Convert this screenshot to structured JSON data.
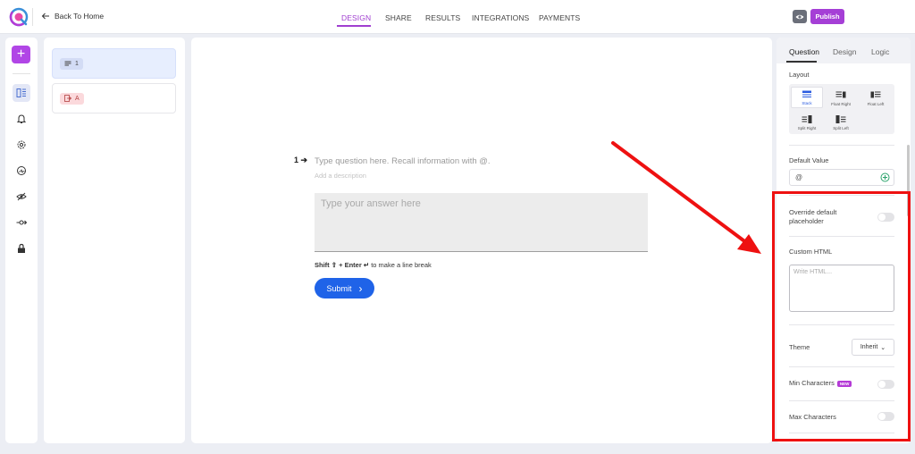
{
  "topbar": {
    "back_label": "Back To Home",
    "tabs": [
      {
        "label": "DESIGN",
        "active": true
      },
      {
        "label": "SHARE",
        "active": false
      },
      {
        "label": "RESULTS",
        "active": false
      },
      {
        "label": "INTEGRATIONS",
        "active": false
      },
      {
        "label": "PAYMENTS",
        "active": false
      }
    ],
    "publish_label": "Publish",
    "accent_color": "#a53fd6"
  },
  "rail": {
    "add_label": "+",
    "icons": [
      "layout-icon",
      "bell-icon",
      "settings-icon",
      "speedometer-icon",
      "eye-off-icon",
      "flow-icon",
      "lock-icon"
    ]
  },
  "questions": {
    "items": [
      {
        "label": "1",
        "icon": "text-lines-icon",
        "active": true
      },
      {
        "label": "A",
        "icon": "exit-icon",
        "active": false
      }
    ]
  },
  "canvas": {
    "number": "1",
    "arrow": "➔",
    "question_placeholder": "Type question here. Recall information with @.",
    "description_placeholder": "Add a description",
    "answer_placeholder": "Type your answer here",
    "hint_shift": "Shift ⇧ + Enter ↵",
    "hint_rest": " to make a line break",
    "submit_label": "Submit",
    "submit_chevron": "›"
  },
  "settings": {
    "tabs": [
      {
        "label": "Question",
        "active": true
      },
      {
        "label": "Design",
        "active": false
      },
      {
        "label": "Logic",
        "active": false
      }
    ],
    "layout_label": "Layout",
    "layout_options": [
      {
        "label": "Stack",
        "active": true
      },
      {
        "label": "Float Right",
        "active": false
      },
      {
        "label": "Float Left",
        "active": false
      },
      {
        "label": "Split Right",
        "active": false
      },
      {
        "label": "Split Left",
        "active": false
      }
    ],
    "default_value_label": "Default Value",
    "default_value": "@",
    "override_label": "Override default placeholder",
    "override_on": false,
    "custom_html_label": "Custom HTML",
    "custom_html_placeholder": "Write HTML...",
    "theme_label": "Theme",
    "theme_value": "Inherit",
    "theme_chevron": "⌄",
    "min_chars_label": "Min Characters",
    "min_chars_badge": "NEW",
    "min_chars_on": false,
    "max_chars_label": "Max Characters",
    "max_chars_on": false
  },
  "annotation": {
    "color": "#ee1111"
  }
}
